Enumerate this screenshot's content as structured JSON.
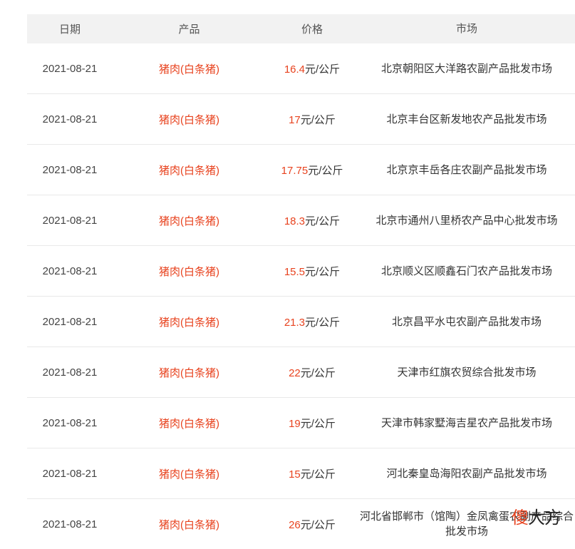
{
  "table": {
    "headers": [
      "日期",
      "产品",
      "价格",
      "市场"
    ],
    "rows": [
      {
        "date": "2021-08-21",
        "product": "猪肉(白条猪)",
        "price_value": "16.4",
        "price_unit": "元/公斤",
        "market": "北京朝阳区大洋路农副产品批发市场"
      },
      {
        "date": "2021-08-21",
        "product": "猪肉(白条猪)",
        "price_value": "17",
        "price_unit": "元/公斤",
        "market": "北京丰台区新发地农产品批发市场"
      },
      {
        "date": "2021-08-21",
        "product": "猪肉(白条猪)",
        "price_value": "17.75",
        "price_unit": "元/公斤",
        "market": "北京京丰岳各庄农副产品批发市场"
      },
      {
        "date": "2021-08-21",
        "product": "猪肉(白条猪)",
        "price_value": "18.3",
        "price_unit": "元/公斤",
        "market": "北京市通州八里桥农产品中心批发市场"
      },
      {
        "date": "2021-08-21",
        "product": "猪肉(白条猪)",
        "price_value": "15.5",
        "price_unit": "元/公斤",
        "market": "北京顺义区顺鑫石门农产品批发市场"
      },
      {
        "date": "2021-08-21",
        "product": "猪肉(白条猪)",
        "price_value": "21.3",
        "price_unit": "元/公斤",
        "market": "北京昌平水屯农副产品批发市场"
      },
      {
        "date": "2021-08-21",
        "product": "猪肉(白条猪)",
        "price_value": "22",
        "price_unit": "元/公斤",
        "market": "天津市红旗农贸综合批发市场"
      },
      {
        "date": "2021-08-21",
        "product": "猪肉(白条猪)",
        "price_value": "19",
        "price_unit": "元/公斤",
        "market": "天津市韩家墅海吉星农产品批发市场"
      },
      {
        "date": "2021-08-21",
        "product": "猪肉(白条猪)",
        "price_value": "15",
        "price_unit": "元/公斤",
        "market": "河北秦皇岛海阳农副产品批发市场"
      },
      {
        "date": "2021-08-21",
        "product": "猪肉(白条猪)",
        "price_value": "26",
        "price_unit": "元/公斤",
        "market": "河北省邯郸市（馆陶）金凤禽蛋农副产品综合批发市场"
      }
    ]
  },
  "watermark": {
    "first": "傻",
    "rest": "大方"
  },
  "colors": {
    "accent": "#e8431f",
    "header_bg": "#f2f2f2",
    "divider": "#e9e9e9"
  }
}
